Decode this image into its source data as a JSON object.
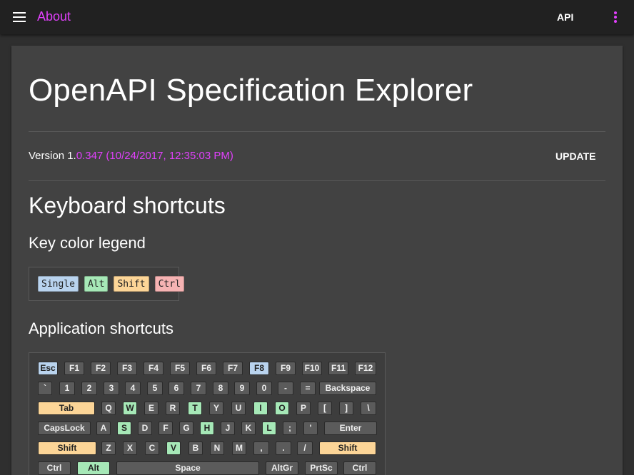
{
  "topbar": {
    "menu_icon": "hamburger-menu-icon",
    "title": "About",
    "api_label": "API",
    "more_icon": "vertical-dots-icon",
    "accent": "#e040fb"
  },
  "page": {
    "title": "OpenAPI Specification Explorer",
    "version_prefix": "Version 1.",
    "version_detail": "0.347 (10/24/2017, 12:35:03 PM)",
    "update_label": "UPDATE",
    "keyboard_heading": "Keyboard shortcuts",
    "legend_heading": "Key color legend",
    "app_shortcuts_heading": "Application shortcuts"
  },
  "legend": [
    {
      "label": "Single",
      "color": "#b9d3ee"
    },
    {
      "label": "Alt",
      "color": "#a6e8b7"
    },
    {
      "label": "Shift",
      "color": "#fcd597"
    },
    {
      "label": "Ctrl",
      "color": "#f6b3b3"
    }
  ],
  "keyboard": {
    "rows": [
      [
        {
          "label": "Esc",
          "type": "single"
        },
        {
          "label": "F1"
        },
        {
          "label": "F2"
        },
        {
          "label": "F3"
        },
        {
          "label": "F4"
        },
        {
          "label": "F5"
        },
        {
          "label": "F6"
        },
        {
          "label": "F7"
        },
        {
          "label": "F8",
          "type": "single"
        },
        {
          "label": "F9"
        },
        {
          "label": "F10"
        },
        {
          "label": "F11"
        },
        {
          "label": "F12"
        }
      ],
      [
        {
          "label": "`"
        },
        {
          "label": "1"
        },
        {
          "label": "2"
        },
        {
          "label": "3"
        },
        {
          "label": "4"
        },
        {
          "label": "5"
        },
        {
          "label": "6"
        },
        {
          "label": "7"
        },
        {
          "label": "8"
        },
        {
          "label": "9"
        },
        {
          "label": "0"
        },
        {
          "label": "-"
        },
        {
          "label": "="
        },
        {
          "label": "Backspace"
        }
      ],
      [
        {
          "label": "Tab",
          "type": "shift"
        },
        {
          "label": "Q"
        },
        {
          "label": "W",
          "type": "alt"
        },
        {
          "label": "E"
        },
        {
          "label": "R"
        },
        {
          "label": "T",
          "type": "alt"
        },
        {
          "label": "Y"
        },
        {
          "label": "U"
        },
        {
          "label": "I",
          "type": "alt"
        },
        {
          "label": "O",
          "type": "alt"
        },
        {
          "label": "P"
        },
        {
          "label": "["
        },
        {
          "label": "]"
        },
        {
          "label": "\\"
        }
      ],
      [
        {
          "label": "CapsLock"
        },
        {
          "label": "A"
        },
        {
          "label": "S",
          "type": "alt"
        },
        {
          "label": "D"
        },
        {
          "label": "F"
        },
        {
          "label": "G"
        },
        {
          "label": "H",
          "type": "alt"
        },
        {
          "label": "J"
        },
        {
          "label": "K"
        },
        {
          "label": "L",
          "type": "alt"
        },
        {
          "label": ";"
        },
        {
          "label": "'"
        },
        {
          "label": "Enter"
        }
      ],
      [
        {
          "label": "Shift",
          "type": "shift"
        },
        {
          "label": "Z"
        },
        {
          "label": "X"
        },
        {
          "label": "C"
        },
        {
          "label": "V",
          "type": "alt"
        },
        {
          "label": "B"
        },
        {
          "label": "N"
        },
        {
          "label": "M"
        },
        {
          "label": ","
        },
        {
          "label": "."
        },
        {
          "label": "/"
        },
        {
          "label": "Shift",
          "type": "shift"
        }
      ],
      [
        {
          "label": "Ctrl"
        },
        {
          "label": "Alt",
          "type": "alt"
        },
        {
          "label": "Space"
        },
        {
          "label": "AltGr"
        },
        {
          "label": "PrtSc"
        },
        {
          "label": "Ctrl"
        }
      ]
    ]
  }
}
